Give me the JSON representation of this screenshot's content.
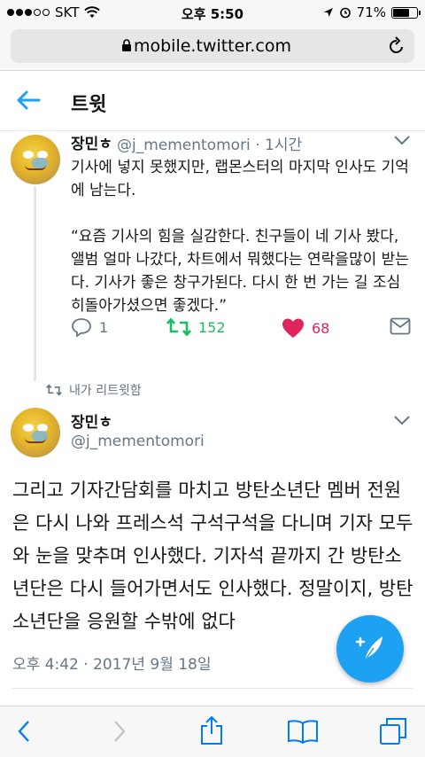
{
  "status_bar": {
    "carrier": "SKT",
    "time": "오후 5:50",
    "battery": "71%",
    "battery_level": 0.71
  },
  "address_bar": {
    "url": "mobile.twitter.com"
  },
  "header": {
    "title": "트윗"
  },
  "parent_tweet": {
    "name": "장민ㅎ",
    "handle": "@j_mementomori",
    "separator": "·",
    "age": "1시간",
    "text": "기사에 넣지 못했지만, 랩몬스터의 마지막 인사도 기억에 남는다.\n\n“요즘 기사의 힘을 실감한다. 친구들이 네 기사 봤다, 앨범 얼마 나갔다, 차트에서 뭐했다는 연락을많이 받는다. 기사가 좋은 창구가된다. 다시 한 번 가는 길 조심히돌아가셨으면 좋겠다.”",
    "reply_count": "1",
    "retweet_count": "152",
    "like_count": "68"
  },
  "retweet_context": {
    "label": "내가 리트윗함"
  },
  "main_tweet": {
    "name": "장민ㅎ",
    "handle": "@j_mementomori",
    "text": "그리고 기자간담회를 마치고 방탄소년단 멤버 전원은 다시 나와 프레스석 구석구석을 다니며 기자 모두와 눈을 맞추며 인사했다. 기자석 끝까지 간 방탄소년단은 다시 들어가면서도 인사했다. 정말이지, 방탄소년단을 응원할 수밖에 없다",
    "timestamp": "오후 4:42 · 2017년 9월 18일"
  },
  "colors": {
    "twitter_blue": "#1da1f2",
    "retweet_green": "#17bf63",
    "like_red": "#e0245e",
    "muted_gray": "#657786",
    "safari_blue": "#007aff"
  },
  "icons": [
    "back-arrow-icon",
    "lock-icon",
    "reload-icon",
    "chevron-down-icon",
    "reply-icon",
    "retweet-icon",
    "heart-icon",
    "mail-icon",
    "compose-icon",
    "share-icon",
    "bookmarks-icon",
    "tabs-icon"
  ]
}
